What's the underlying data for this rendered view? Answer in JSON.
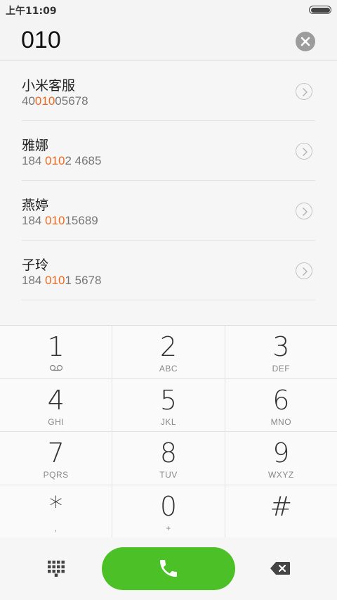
{
  "status_bar": {
    "time": "上午11:09"
  },
  "dialer": {
    "input_value": "010"
  },
  "results": [
    {
      "name": "小米客服",
      "number_pre": "40",
      "number_match": "010",
      "number_post": "05678"
    },
    {
      "name": "雅娜",
      "number_pre": "184 ",
      "number_match": "010",
      "number_post": "2 4685"
    },
    {
      "name": "燕婷",
      "number_pre": "184 ",
      "number_match": "010",
      "number_post": "15689"
    },
    {
      "name": "子玲",
      "number_pre": "184 ",
      "number_match": "010",
      "number_post": "1 5678"
    }
  ],
  "keypad": {
    "rows": [
      [
        {
          "digit": "1",
          "letters": ""
        },
        {
          "digit": "2",
          "letters": "ABC"
        },
        {
          "digit": "3",
          "letters": "DEF"
        }
      ],
      [
        {
          "digit": "4",
          "letters": "GHI"
        },
        {
          "digit": "5",
          "letters": "JKL"
        },
        {
          "digit": "6",
          "letters": "MNO"
        }
      ],
      [
        {
          "digit": "7",
          "letters": "PQRS"
        },
        {
          "digit": "8",
          "letters": "TUV"
        },
        {
          "digit": "9",
          "letters": "WXYZ"
        }
      ],
      [
        {
          "digit": "*",
          "letters": ","
        },
        {
          "digit": "0",
          "letters": "+"
        },
        {
          "digit": "#",
          "letters": ""
        }
      ]
    ]
  },
  "icons": {
    "clear": "clear-input-icon",
    "detail": "chevron-right-circle-icon",
    "voicemail": "voicemail-icon",
    "dialpad": "dialpad-grid-icon",
    "call": "phone-icon",
    "backspace": "backspace-icon"
  },
  "colors": {
    "highlight": "#f06a1c",
    "call_button": "#4cc027"
  }
}
